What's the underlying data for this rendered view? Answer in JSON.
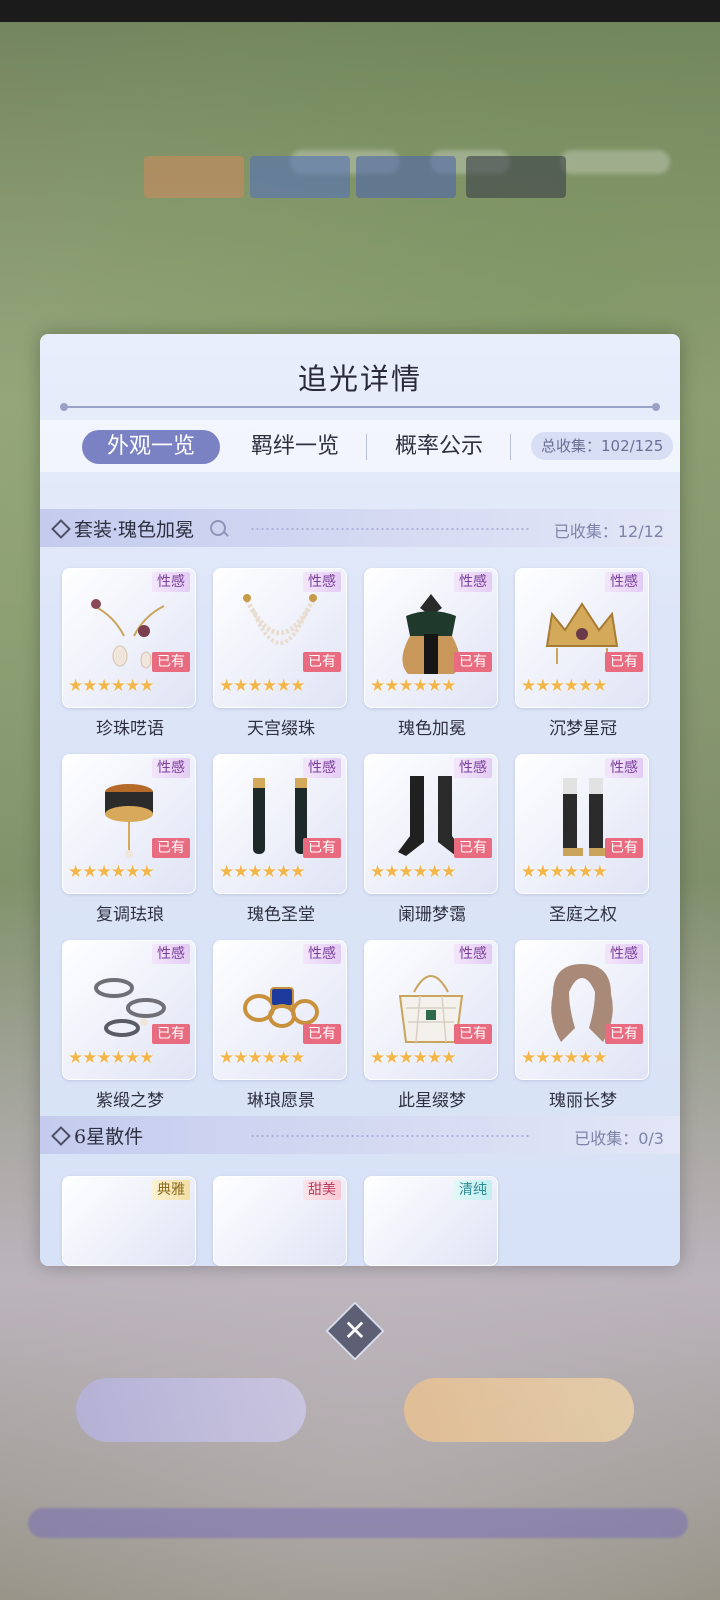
{
  "panel": {
    "title": "追光详情",
    "tabs": [
      "外观一览",
      "羁绊一览",
      "概率公示"
    ],
    "total_collect": "总收集：102/125"
  },
  "suit_section": {
    "title": "套装·瑰色加冕",
    "count": "已收集：12/12",
    "items": [
      {
        "name": "珍珠呓语",
        "tag": "性感",
        "owned": "已有",
        "stars": "★★★★★★"
      },
      {
        "name": "天宫缀珠",
        "tag": "性感",
        "owned": "已有",
        "stars": "★★★★★★"
      },
      {
        "name": "瑰色加冕",
        "tag": "性感",
        "owned": "已有",
        "stars": "★★★★★★"
      },
      {
        "name": "沉梦星冠",
        "tag": "性感",
        "owned": "已有",
        "stars": "★★★★★★"
      },
      {
        "name": "复调珐琅",
        "tag": "性感",
        "owned": "已有",
        "stars": "★★★★★★"
      },
      {
        "name": "瑰色圣堂",
        "tag": "性感",
        "owned": "已有",
        "stars": "★★★★★★"
      },
      {
        "name": "阑珊梦霭",
        "tag": "性感",
        "owned": "已有",
        "stars": "★★★★★★"
      },
      {
        "name": "圣庭之权",
        "tag": "性感",
        "owned": "已有",
        "stars": "★★★★★★"
      },
      {
        "name": "紫缎之梦",
        "tag": "性感",
        "owned": "已有",
        "stars": "★★★★★★"
      },
      {
        "name": "琳琅愿景",
        "tag": "性感",
        "owned": "已有",
        "stars": "★★★★★★"
      },
      {
        "name": "此星缀梦",
        "tag": "性感",
        "owned": "已有",
        "stars": "★★★★★★"
      },
      {
        "name": "瑰丽长梦",
        "tag": "性感",
        "owned": "已有",
        "stars": "★★★★★★"
      }
    ]
  },
  "six_star_section": {
    "title": "6星散件",
    "count": "已收集：0/3",
    "tags": [
      "典雅",
      "甜美",
      "清纯"
    ]
  },
  "close_symbol": "✕"
}
